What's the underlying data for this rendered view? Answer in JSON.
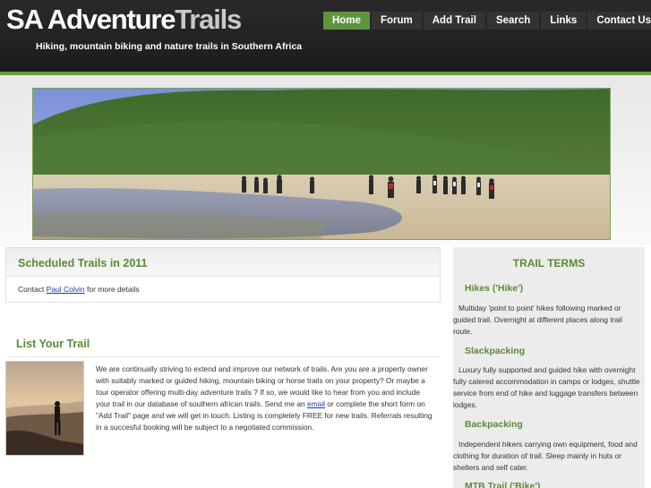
{
  "header": {
    "logo_main": "SA Adventure",
    "logo_accent": "Trails",
    "tagline": "Hiking, mountain biking and nature trails in Southern Africa"
  },
  "nav": {
    "items": [
      {
        "label": "Home",
        "active": true
      },
      {
        "label": "Forum"
      },
      {
        "label": "Add Trail"
      },
      {
        "label": "Search"
      },
      {
        "label": "Links"
      },
      {
        "label": "Contact Us"
      }
    ]
  },
  "scheduled": {
    "title": "Scheduled Trails in 2011",
    "text_before": "Contact ",
    "link": "Paul Colvin",
    "text_after": " for more details"
  },
  "list_trail": {
    "title": "List Your Trail",
    "body_before": "We are continually striving to extend and improve our network of trails. Are you are a property owner with suitably marked or guided hiking, mountain biking or horse trails on your property? Or maybe a tour operator offering multi-day adventure trails ? If so, we would like to hear from you and include your trail in our database of southern african trails. Send me an ",
    "body_link": "email",
    "body_after": " or complete the short form on \"Add Trail\" page and we will get in touch. Listing is completely FREE for new trails. Referrals resulting in a succesful booking will be subject to a negotiated commission."
  },
  "sidebar": {
    "title": "TRAIL TERMS",
    "terms": [
      {
        "title": "Hikes ('Hike')",
        "text": "Multiday 'point to point' hikes following marked or guided trail. Overnight at different places along trail route."
      },
      {
        "title": "Slackpacking",
        "text": "Luxury fully supported and guided hike with overnight fully catered accommodation in camps or lodges, shuttle service from end of hike and luggage transfers between lodges."
      },
      {
        "title": "Backpacking",
        "text": "Independent hikers carrying own equipment, food and clothing for duration of trail. Sleep mainly in huts or shelters and self cater."
      },
      {
        "title": "MTB Trail ('Bike')",
        "text": ""
      }
    ]
  },
  "colors": {
    "accent_green": "#5a8a35",
    "nav_active": "#5e9440",
    "header_bg": "#222222",
    "link_blue": "#1a3ea8"
  }
}
